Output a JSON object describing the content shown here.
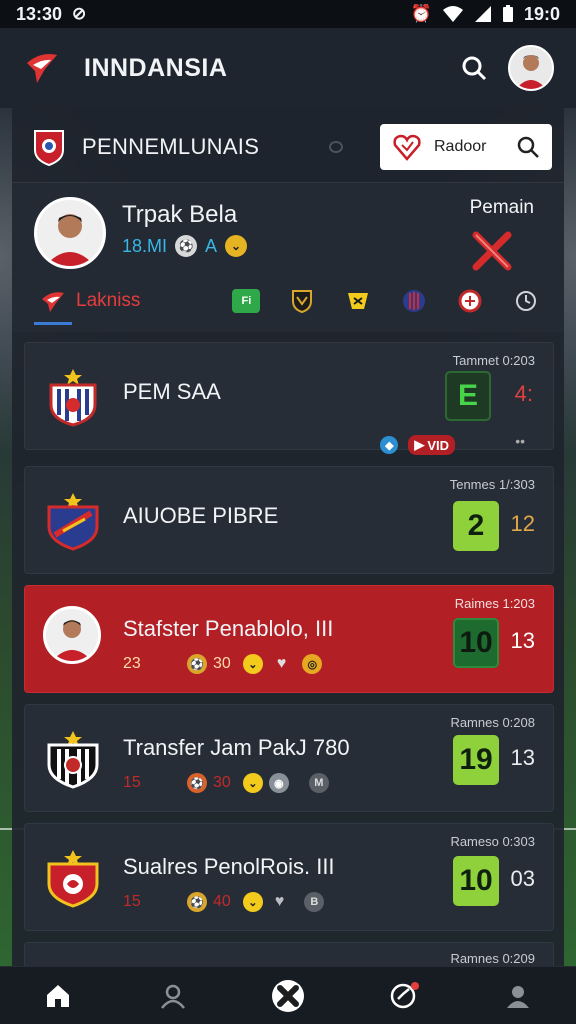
{
  "status": {
    "time": "13:30",
    "right_time": "19:0"
  },
  "app": {
    "title": "INNDANSIA",
    "search_placeholder": "Radoor"
  },
  "league": {
    "title": "PENNEMLUNAIS"
  },
  "profile": {
    "name": "Trpak Bela",
    "stat_number": "18.MI",
    "stat_letter": "A",
    "label": "Pemain",
    "tab_label": "Lakniss",
    "tab_badges": [
      "Fi",
      "",
      "",
      "",
      "",
      ""
    ]
  },
  "cards": [
    {
      "title": "PEM  SAA",
      "meta": "Tammet 0:203",
      "score": "E",
      "side": "4:",
      "badge_text": "VID"
    },
    {
      "title": "AIUOBE PIBRE",
      "meta": "Tenmes 1/:303",
      "score": "2",
      "side": "12"
    },
    {
      "title": "Stafster Penablolo, III",
      "meta": "Raimes 1:203",
      "score": "10",
      "side": "13",
      "sub_num": "23",
      "sub_val": "30"
    },
    {
      "title": "Transfer Jam PakJ 780",
      "meta": "Ramnes 0:208",
      "score": "19",
      "side": "13",
      "sub_num": "15",
      "sub_val": "30"
    },
    {
      "title": "Sualres PenolRois. III",
      "meta": "Rameso 0:303",
      "score": "10",
      "side": "03",
      "sub_num": "15",
      "sub_val": "40"
    },
    {
      "title": "",
      "meta": "Ramnes 0:209"
    }
  ],
  "colors": {
    "accent_red": "#b21f24",
    "score_green": "#8fd13a",
    "score_dark_green": "#1d6b2e",
    "link_blue": "#38b6e6"
  },
  "icons": {
    "nav": [
      "home-icon",
      "profile-icon",
      "football-icon",
      "notification-icon",
      "account-icon"
    ]
  }
}
